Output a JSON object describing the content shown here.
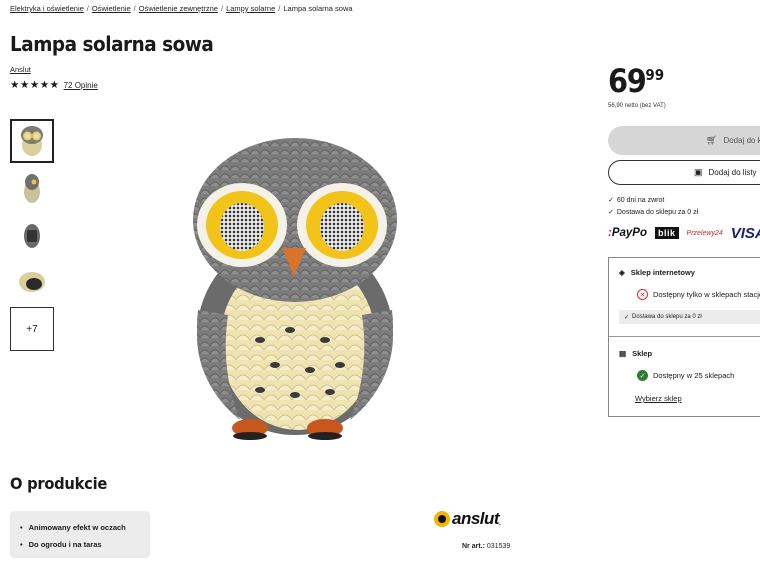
{
  "breadcrumb": [
    "Elektryka i oświetlenie",
    "Oświetlenie",
    "Oświetlenie zewnętrzne",
    "Lampy solarne",
    "Lampa solarna sowa"
  ],
  "product": {
    "title": "Lampa solarna sowa",
    "brand": "Anslut",
    "stars": "★★★★★",
    "rating_value": 4.5,
    "reviews": "72 Opinie"
  },
  "gallery": {
    "more_label": "+7"
  },
  "pricing": {
    "main": "69",
    "cents": "99",
    "netto": "56,90 netto (bez VAT)"
  },
  "actions": {
    "cart_label": "Dodaj do koszyka",
    "list_label": "Dodaj do listy"
  },
  "benefits": [
    "60 dni na zwrot",
    "Dostawa do sklepu za 0 zł"
  ],
  "payments": {
    "paypo": "PayPo",
    "blik": "blik",
    "przelewy": "Przelewy24",
    "visa": "VISA"
  },
  "availability": {
    "online_title": "Sklep internetowy",
    "online_status": "Dostępny tylko w sklepach stacjonarnych",
    "delivery_note": "Dostawa do sklepu za 0 zł",
    "store_title": "Sklep",
    "store_status": "Dostępny w 25 sklepach",
    "choose_store": "Wybierz sklep"
  },
  "about": {
    "title": "O produkcie",
    "features": [
      "Animowany efekt w oczach",
      "Do ogrodu i na taras"
    ],
    "logo": "anslut",
    "art_label": "Nr art.:",
    "art_number": "031539"
  },
  "colors": {
    "accent": "#f2b600",
    "error": "#d32f2f",
    "success": "#2e7d32"
  }
}
